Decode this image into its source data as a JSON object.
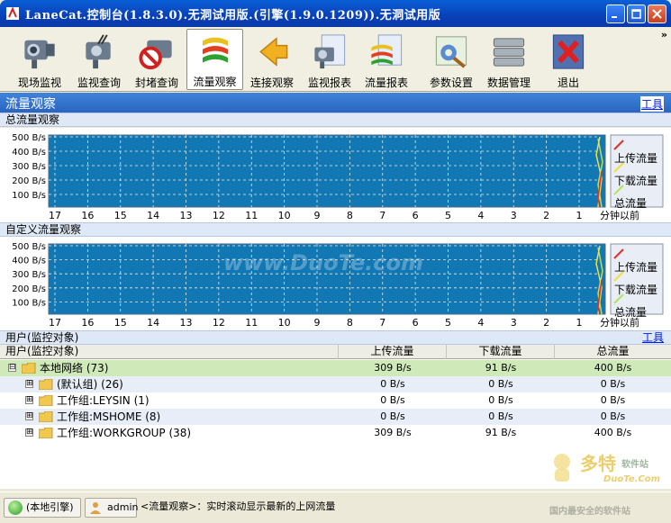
{
  "window": {
    "title": "LaneCat.控制台(1.8.3.0).无洞试用版.(引擎(1.9.0.1209)).无洞试用版"
  },
  "toolbar": {
    "buttons": [
      {
        "label": "现场监视",
        "icon": "camera-icon"
      },
      {
        "label": "监视查询",
        "icon": "camera-search-icon"
      },
      {
        "label": "封堵查询",
        "icon": "block-icon"
      },
      {
        "label": "流量观察",
        "icon": "traffic-icon"
      },
      {
        "label": "连接观察",
        "icon": "connection-arrow-icon"
      },
      {
        "label": "监视报表",
        "icon": "camera-report-icon"
      },
      {
        "label": "流量报表",
        "icon": "traffic-report-icon"
      },
      {
        "label": "参数设置",
        "icon": "settings-icon"
      },
      {
        "label": "数据管理",
        "icon": "database-icon"
      },
      {
        "label": "退出",
        "icon": "exit-icon"
      }
    ],
    "active": "流量观察",
    "more": "»"
  },
  "panel": {
    "title": "流量观察",
    "tools_link": "工具"
  },
  "total_section": {
    "title": "总流量观察"
  },
  "custom_section": {
    "title": "自定义流量观察"
  },
  "users_section": {
    "title": "用户(监控对象)",
    "tools_link": "工具"
  },
  "chart_data": [
    {
      "type": "line",
      "title": "总流量观察",
      "y_ticks": [
        "500 B/s",
        "400 B/s",
        "300 B/s",
        "200 B/s",
        "100 B/s"
      ],
      "ylim": [
        0,
        500
      ],
      "x_ticks": [
        "17",
        "16",
        "15",
        "14",
        "13",
        "12",
        "11",
        "10",
        "9",
        "8",
        "7",
        "6",
        "5",
        "4",
        "3",
        "2",
        "1"
      ],
      "xlabel": "分钟以前",
      "grid": true,
      "legend_position": "right",
      "series": [
        {
          "name": "上传流量",
          "color": "#e0302a"
        },
        {
          "name": "下载流量",
          "color": "#f0e040"
        },
        {
          "name": "总流量",
          "color": "#b8e060"
        }
      ]
    },
    {
      "type": "line",
      "title": "自定义流量观察",
      "y_ticks": [
        "500 B/s",
        "400 B/s",
        "300 B/s",
        "200 B/s",
        "100 B/s"
      ],
      "ylim": [
        0,
        500
      ],
      "x_ticks": [
        "17",
        "16",
        "15",
        "14",
        "13",
        "12",
        "11",
        "10",
        "9",
        "8",
        "7",
        "6",
        "5",
        "4",
        "3",
        "2",
        "1"
      ],
      "xlabel": "分钟以前",
      "grid": true,
      "legend_position": "right",
      "series": [
        {
          "name": "上传流量",
          "color": "#e0302a"
        },
        {
          "name": "下载流量",
          "color": "#f0e040"
        },
        {
          "name": "总流量",
          "color": "#b8e060"
        }
      ]
    }
  ],
  "table": {
    "columns": [
      "用户(监控对象)",
      "上传流量",
      "下载流量",
      "总流量"
    ],
    "rows": [
      {
        "expander": "⊟",
        "name": "本地网络 (73)",
        "up": "309 B/s",
        "down": "91 B/s",
        "total": "400 B/s"
      },
      {
        "expander": "⊞",
        "name": "(默认组) (26)",
        "up": "0 B/s",
        "down": "0 B/s",
        "total": "0 B/s"
      },
      {
        "expander": "⊞",
        "name": "工作组:LEYSIN (1)",
        "up": "0 B/s",
        "down": "0 B/s",
        "total": "0 B/s"
      },
      {
        "expander": "⊞",
        "name": "工作组:MSHOME (8)",
        "up": "0 B/s",
        "down": "0 B/s",
        "total": "0 B/s"
      },
      {
        "expander": "⊞",
        "name": "工作组:WORKGROUP (38)",
        "up": "309 B/s",
        "down": "91 B/s",
        "total": "400 B/s"
      }
    ]
  },
  "statusbar": {
    "engine": "(本地引擎)",
    "user": "admin",
    "message": "<流量观察>：实时滚动显示最新的上网流量"
  },
  "watermarks": {
    "center": "www.DuoTe.com",
    "brand_main": "多特",
    "brand_suffix": "软件站",
    "brand_url": "DuoTe.Com",
    "brand_slogan": "国内最安全的软件站"
  },
  "colors": {
    "chart_bg": "#1278b4",
    "grid": "#ffffff",
    "panel_head": "#3a78d0",
    "root_row": "#cfe9b8"
  }
}
